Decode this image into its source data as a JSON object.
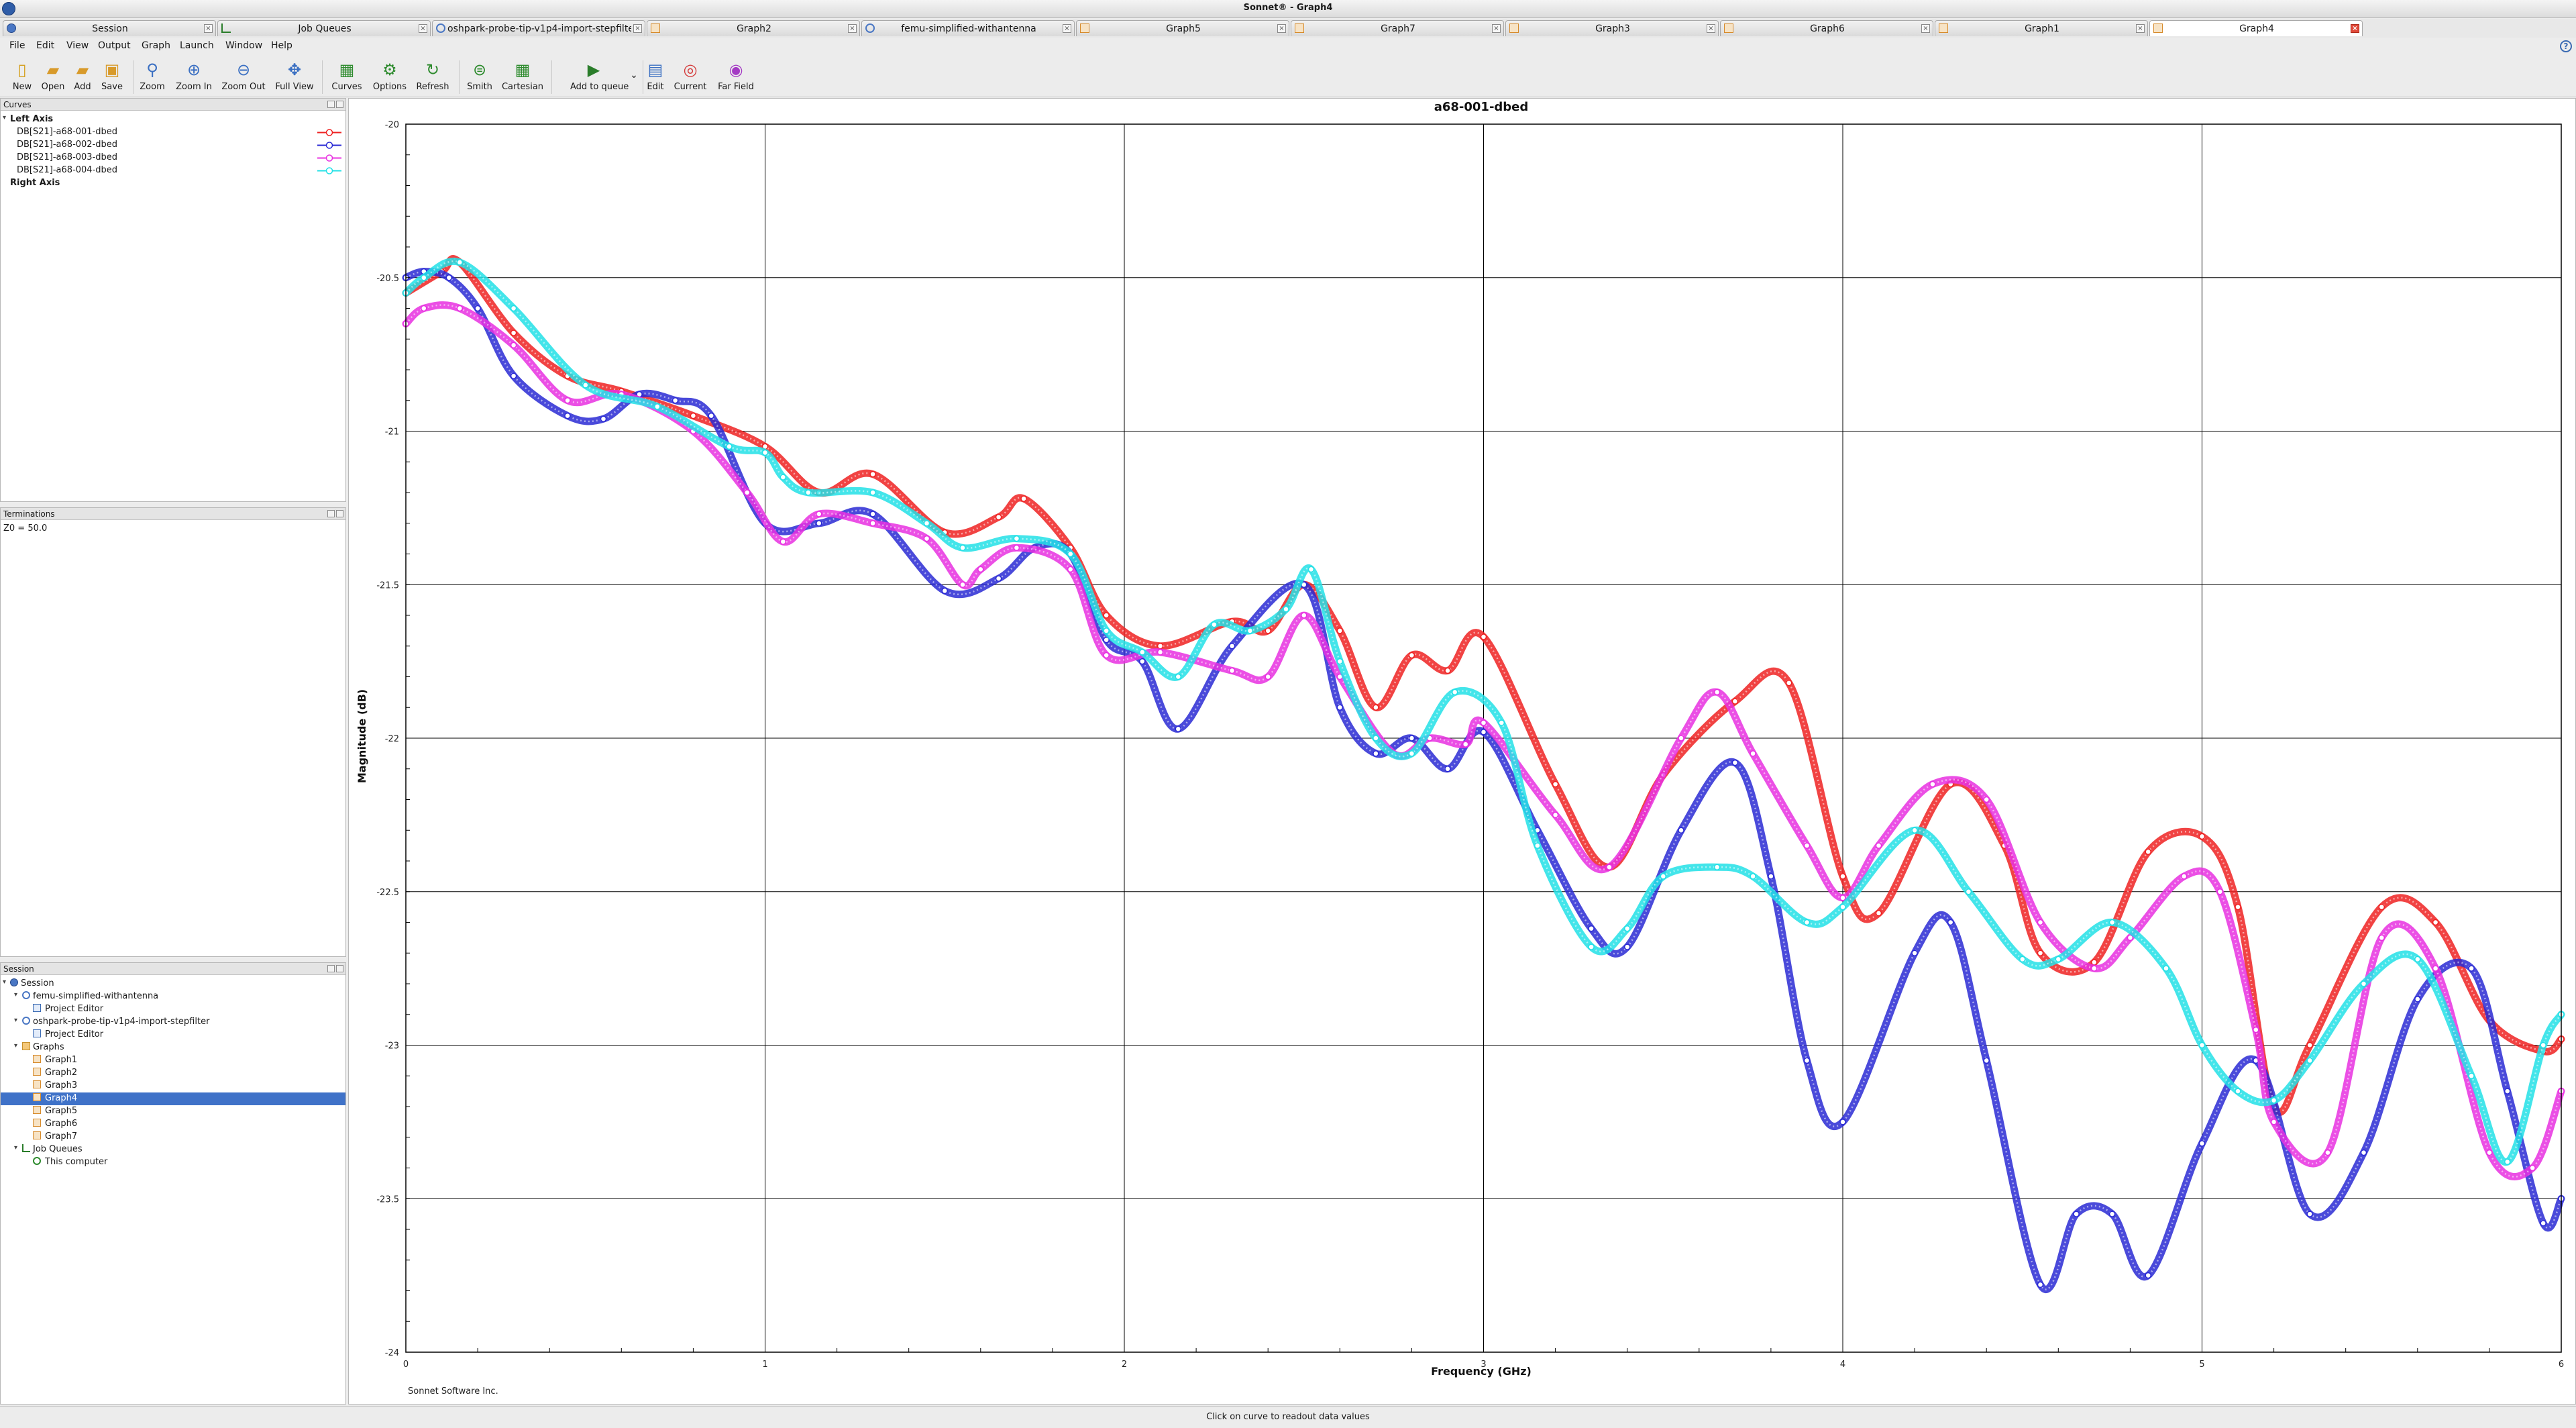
{
  "window": {
    "title": "Sonnet® - Graph4"
  },
  "tabs": [
    {
      "label": "Session",
      "icon": "session-icon"
    },
    {
      "label": "Job Queues",
      "icon": "job-queue-icon"
    },
    {
      "label": "oshpark-probe-tip-v1p4-import-stepfilter",
      "icon": "project-icon"
    },
    {
      "label": "Graph2",
      "icon": "graph-icon"
    },
    {
      "label": "femu-simplified-withantenna",
      "icon": "project-icon"
    },
    {
      "label": "Graph5",
      "icon": "graph-icon"
    },
    {
      "label": "Graph7",
      "icon": "graph-icon"
    },
    {
      "label": "Graph3",
      "icon": "graph-icon"
    },
    {
      "label": "Graph6",
      "icon": "graph-icon"
    },
    {
      "label": "Graph1",
      "icon": "graph-icon"
    },
    {
      "label": "Graph4",
      "icon": "graph-icon",
      "active": true
    }
  ],
  "menu": [
    "File",
    "Edit",
    "View",
    "Output",
    "Graph",
    "Launch",
    "Window",
    "Help"
  ],
  "toolbar": {
    "new": "New",
    "open": "Open",
    "add": "Add",
    "save": "Save",
    "zoom": "Zoom",
    "zoom_in": "Zoom In",
    "zoom_out": "Zoom Out",
    "full_view": "Full View",
    "curves": "Curves",
    "options": "Options",
    "refresh": "Refresh",
    "smith": "Smith",
    "cartesian": "Cartesian",
    "add_to_queue": "Add to queue",
    "edit": "Edit",
    "current": "Current",
    "far_field": "Far Field"
  },
  "curves_panel": {
    "title": "Curves",
    "left_axis": "Left Axis",
    "right_axis": "Right Axis",
    "items": [
      {
        "label": "DB[S21]-a68-001-dbed",
        "color": "#ee2222"
      },
      {
        "label": "DB[S21]-a68-002-dbed",
        "color": "#2a2ad4"
      },
      {
        "label": "DB[S21]-a68-003-dbed",
        "color": "#e830e0"
      },
      {
        "label": "DB[S21]-a68-004-dbed",
        "color": "#22e0e6"
      }
    ]
  },
  "terminations_panel": {
    "title": "Terminations",
    "text": "Z0 = 50.0"
  },
  "session_panel": {
    "title": "Session",
    "tree": {
      "root": "Session",
      "project1": "femu-simplified-withantenna",
      "project1_editor": "Project Editor",
      "project2": "oshpark-probe-tip-v1p4-import-stepfilter",
      "project2_editor": "Project Editor",
      "graphs": "Graphs",
      "graph_items": [
        "Graph1",
        "Graph2",
        "Graph3",
        "Graph4",
        "Graph5",
        "Graph6",
        "Graph7"
      ],
      "job_queues": "Job Queues",
      "this_computer": "This computer"
    }
  },
  "graph_footer": "Sonnet Software Inc.",
  "status": "Click on curve to readout data values",
  "chart_data": {
    "type": "line",
    "title": "a68-001-dbed",
    "xlabel": "Frequency (GHz)",
    "ylabel": "Magnitude (dB)",
    "xlim": [
      0,
      6
    ],
    "ylim": [
      -24,
      -20
    ],
    "xticks": [
      "0",
      "1",
      "2",
      "3",
      "4",
      "5",
      "6"
    ],
    "yticks": [
      "-20",
      "-20.5",
      "-21",
      "-21.5",
      "-22",
      "-22.5",
      "-23",
      "-23.5",
      "-24"
    ],
    "grid": true,
    "series": [
      {
        "name": "DB[S21]-a68-001-dbed",
        "color": "#ee2222",
        "x": [
          0,
          0.1,
          0.15,
          0.3,
          0.45,
          0.6,
          0.8,
          1.0,
          1.15,
          1.3,
          1.5,
          1.65,
          1.72,
          1.85,
          1.95,
          2.1,
          2.3,
          2.4,
          2.5,
          2.6,
          2.7,
          2.8,
          2.9,
          3.0,
          3.2,
          3.35,
          3.5,
          3.7,
          3.85,
          4.0,
          4.1,
          4.3,
          4.45,
          4.55,
          4.7,
          4.85,
          5.0,
          5.1,
          5.2,
          5.3,
          5.5,
          5.65,
          5.8,
          5.95,
          6.0
        ],
        "y": [
          -20.55,
          -20.48,
          -20.45,
          -20.68,
          -20.82,
          -20.87,
          -20.95,
          -21.05,
          -21.2,
          -21.14,
          -21.33,
          -21.28,
          -21.22,
          -21.38,
          -21.6,
          -21.7,
          -21.62,
          -21.65,
          -21.5,
          -21.65,
          -21.9,
          -21.73,
          -21.78,
          -21.67,
          -22.15,
          -22.42,
          -22.12,
          -21.88,
          -21.82,
          -22.45,
          -22.57,
          -22.15,
          -22.35,
          -22.7,
          -22.73,
          -22.37,
          -22.32,
          -22.55,
          -23.2,
          -23.0,
          -22.55,
          -22.6,
          -22.92,
          -23.02,
          -22.98
        ]
      },
      {
        "name": "DB[S21]-a68-002-dbed",
        "color": "#2a2ad4",
        "x": [
          0,
          0.05,
          0.12,
          0.2,
          0.3,
          0.45,
          0.55,
          0.65,
          0.75,
          0.85,
          1.0,
          1.15,
          1.3,
          1.5,
          1.65,
          1.75,
          1.85,
          1.95,
          2.05,
          2.15,
          2.3,
          2.5,
          2.6,
          2.7,
          2.8,
          2.9,
          3.0,
          3.15,
          3.3,
          3.4,
          3.55,
          3.7,
          3.8,
          3.9,
          4.0,
          4.2,
          4.3,
          4.4,
          4.55,
          4.65,
          4.75,
          4.85,
          5.0,
          5.15,
          5.3,
          5.45,
          5.6,
          5.75,
          5.85,
          5.95,
          6.0
        ],
        "y": [
          -20.5,
          -20.48,
          -20.5,
          -20.6,
          -20.82,
          -20.95,
          -20.96,
          -20.88,
          -20.9,
          -20.95,
          -21.3,
          -21.3,
          -21.27,
          -21.52,
          -21.48,
          -21.38,
          -21.4,
          -21.68,
          -21.75,
          -21.97,
          -21.7,
          -21.5,
          -21.9,
          -22.05,
          -22.0,
          -22.1,
          -21.98,
          -22.3,
          -22.62,
          -22.68,
          -22.3,
          -22.08,
          -22.45,
          -23.05,
          -23.25,
          -22.7,
          -22.6,
          -23.05,
          -23.78,
          -23.55,
          -23.55,
          -23.75,
          -23.32,
          -23.05,
          -23.55,
          -23.35,
          -22.85,
          -22.75,
          -23.15,
          -23.58,
          -23.5
        ]
      },
      {
        "name": "DB[S21]-a68-003-dbed",
        "color": "#e830e0",
        "x": [
          0,
          0.05,
          0.15,
          0.3,
          0.45,
          0.6,
          0.8,
          0.95,
          1.05,
          1.15,
          1.3,
          1.45,
          1.55,
          1.6,
          1.7,
          1.85,
          1.95,
          2.1,
          2.3,
          2.4,
          2.5,
          2.6,
          2.75,
          2.85,
          2.95,
          3.0,
          3.2,
          3.35,
          3.55,
          3.65,
          3.75,
          3.9,
          4.0,
          4.1,
          4.25,
          4.4,
          4.55,
          4.7,
          4.8,
          4.95,
          5.05,
          5.15,
          5.2,
          5.35,
          5.5,
          5.65,
          5.8,
          5.92,
          6.0
        ],
        "y": [
          -20.65,
          -20.6,
          -20.6,
          -20.72,
          -20.9,
          -20.88,
          -21.0,
          -21.2,
          -21.36,
          -21.27,
          -21.3,
          -21.35,
          -21.5,
          -21.45,
          -21.38,
          -21.45,
          -21.73,
          -21.72,
          -21.78,
          -21.8,
          -21.6,
          -21.8,
          -22.05,
          -22.0,
          -22.02,
          -21.95,
          -22.25,
          -22.42,
          -22.0,
          -21.85,
          -22.05,
          -22.35,
          -22.52,
          -22.35,
          -22.15,
          -22.2,
          -22.6,
          -22.75,
          -22.65,
          -22.45,
          -22.5,
          -22.95,
          -23.25,
          -23.35,
          -22.65,
          -22.75,
          -23.35,
          -23.4,
          -23.15
        ]
      },
      {
        "name": "DB[S21]-a68-004-dbed",
        "color": "#22e0e6",
        "x": [
          0,
          0.05,
          0.15,
          0.3,
          0.5,
          0.7,
          0.9,
          1.0,
          1.05,
          1.12,
          1.3,
          1.45,
          1.55,
          1.7,
          1.85,
          1.95,
          2.05,
          2.15,
          2.25,
          2.35,
          2.45,
          2.52,
          2.6,
          2.7,
          2.8,
          2.92,
          3.05,
          3.15,
          3.3,
          3.4,
          3.5,
          3.65,
          3.75,
          3.9,
          4.0,
          4.2,
          4.35,
          4.5,
          4.6,
          4.75,
          4.9,
          5.0,
          5.1,
          5.2,
          5.3,
          5.45,
          5.6,
          5.75,
          5.85,
          5.95,
          6.0
        ],
        "y": [
          -20.55,
          -20.5,
          -20.45,
          -20.6,
          -20.85,
          -20.92,
          -21.05,
          -21.07,
          -21.15,
          -21.2,
          -21.2,
          -21.3,
          -21.38,
          -21.35,
          -21.4,
          -21.65,
          -21.72,
          -21.8,
          -21.63,
          -21.65,
          -21.58,
          -21.45,
          -21.75,
          -22.0,
          -22.05,
          -21.85,
          -21.95,
          -22.35,
          -22.68,
          -22.62,
          -22.45,
          -22.42,
          -22.45,
          -22.6,
          -22.55,
          -22.3,
          -22.5,
          -22.72,
          -22.72,
          -22.6,
          -22.75,
          -23.0,
          -23.15,
          -23.18,
          -23.05,
          -22.8,
          -22.72,
          -23.1,
          -23.38,
          -23.0,
          -22.9
        ]
      }
    ]
  }
}
